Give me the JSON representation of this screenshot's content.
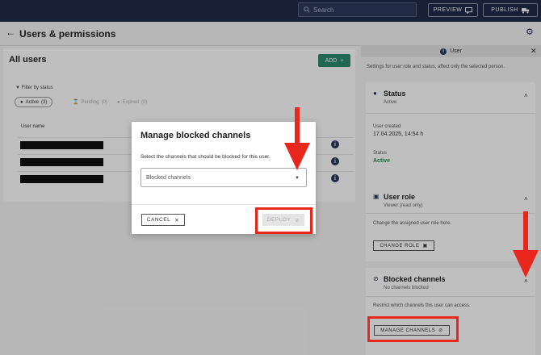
{
  "topbar": {
    "search_placeholder": "Search",
    "preview_label": "PREVIEW",
    "publish_label": "PUBLISH"
  },
  "page": {
    "title": "Users & permissions"
  },
  "users_panel": {
    "title": "All users",
    "add_label": "ADD",
    "filter_label": "Filter by status",
    "filters": [
      {
        "label": "Active",
        "count": "(3)"
      },
      {
        "label": "Pending",
        "count": "(0)"
      },
      {
        "label": "Expired",
        "count": "(0)"
      }
    ],
    "column_header": "User name"
  },
  "detail_panel": {
    "header": "User",
    "description": "Settings for user role and status, affect only the selected person.",
    "status": {
      "title": "Status",
      "subtitle": "Active",
      "created_label": "User created",
      "created_value": "17.04.2025, 14:54 h",
      "status_label": "Status",
      "status_value": "Active"
    },
    "user_role": {
      "title": "User role",
      "subtitle": "Viewer (read only)",
      "description": "Change the assigned user role here.",
      "button_label": "CHANGE ROLE"
    },
    "blocked_channels": {
      "title": "Blocked channels",
      "subtitle": "No channels blocked",
      "description": "Restrict which channels this user can access.",
      "button_label": "MANAGE CHANNELS"
    }
  },
  "modal": {
    "title": "Manage blocked channels",
    "description": "Select the channels that should be blocked for this user.",
    "select_placeholder": "Blocked channels",
    "cancel_label": "CANCEL",
    "deploy_label": "DEPLOY"
  },
  "colors": {
    "navbar": "#1f2b4a",
    "accent_green": "#2c8a6c",
    "annotation_red": "#e8261c"
  }
}
